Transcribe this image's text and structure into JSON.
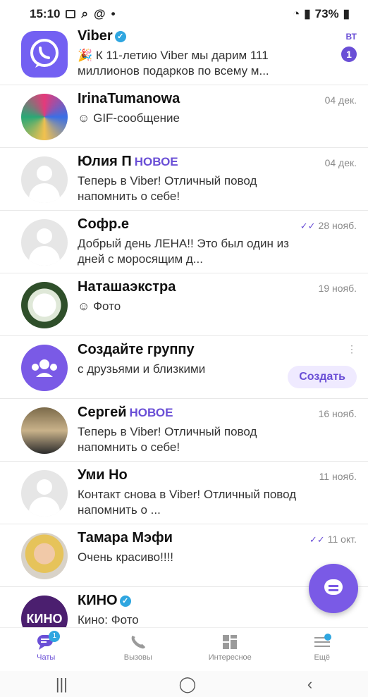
{
  "status": {
    "time": "15:10",
    "battery": "73%"
  },
  "chats": [
    {
      "name": "Viber",
      "verified": true,
      "message": "🎉 К 11-летию Viber мы дарим 111 миллионов подарков по всему м...",
      "date": "ВТ",
      "unread": "1",
      "avatar": "viber"
    },
    {
      "name": "IrinaTumanowa",
      "message": "GIF-сообщение",
      "msg_icon": "gif-icon",
      "date": "04 дек.",
      "avatar": "photo"
    },
    {
      "name": "Юлия П",
      "new_label": "НОВОЕ",
      "message": "Теперь в Viber! Отличный повод напомнить о себе!",
      "date": "04 дек.",
      "avatar": "placeholder"
    },
    {
      "name": "Софр.е",
      "message": "Добрый день ЛЕНА!! Это был один из дней с моросящим д...",
      "date": "28 нояб.",
      "read": true,
      "avatar": "placeholder"
    },
    {
      "name": "Наташаэкстра",
      "message": "Фото",
      "msg_icon": "photo-icon",
      "date": "19 нояб.",
      "avatar": "photo"
    },
    {
      "name": "Создайте группу",
      "message": "с друзьями и близкими",
      "button": "Создать",
      "avatar": "group"
    },
    {
      "name": "Сергей",
      "new_label": "НОВОЕ",
      "message": "Теперь в Viber! Отличный повод напомнить о себе!",
      "date": "16 нояб.",
      "avatar": "photo"
    },
    {
      "name": "Уми Но",
      "message": "Контакт снова в Viber! Отличный повод напомнить о ...",
      "date": "11 нояб.",
      "avatar": "placeholder"
    },
    {
      "name": "Тамара Мэфи",
      "message": "Очень красиво!!!!",
      "date": "11 окт.",
      "read": true,
      "avatar": "photo"
    },
    {
      "name": "КИНО",
      "verified": true,
      "message": "Кино: Фото",
      "avatar": "kino",
      "avatar_text": "КИНО"
    }
  ],
  "tabs": [
    {
      "label": "Чаты",
      "badge": "1",
      "active": true
    },
    {
      "label": "Вызовы"
    },
    {
      "label": "Интересное"
    },
    {
      "label": "Ещё"
    }
  ],
  "colors": {
    "accent": "#6a4fd6",
    "verified": "#2fa6e0"
  }
}
